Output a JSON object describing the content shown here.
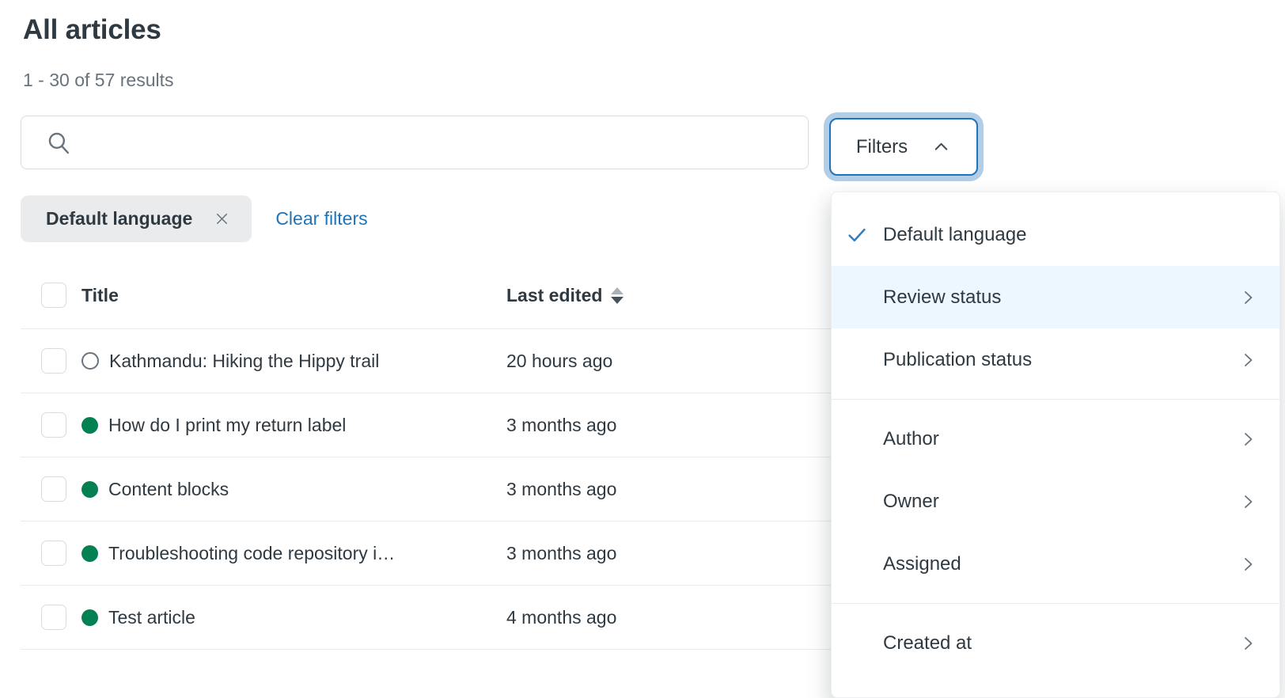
{
  "page": {
    "title": "All articles",
    "results_summary": "1 - 30 of 57 results"
  },
  "search": {
    "value": "",
    "placeholder": ""
  },
  "filters_button": {
    "label": "Filters",
    "state": "open"
  },
  "active_filters": {
    "chips": [
      {
        "label": "Default language"
      }
    ],
    "clear_label": "Clear filters"
  },
  "table": {
    "columns": {
      "title": "Title",
      "last_edited": "Last edited"
    },
    "sort": {
      "column": "last_edited",
      "direction": "descending"
    },
    "rows": [
      {
        "status": "draft",
        "title": "Kathmandu: Hiking the Hippy trail",
        "last_edited": "20 hours ago"
      },
      {
        "status": "published",
        "title": "How do I print my return label",
        "last_edited": "3 months ago"
      },
      {
        "status": "published",
        "title": "Content blocks",
        "last_edited": "3 months ago"
      },
      {
        "status": "published",
        "title": "Troubleshooting code repository i…",
        "last_edited": "3 months ago"
      },
      {
        "status": "published",
        "title": "Test article",
        "last_edited": "4 months ago"
      }
    ]
  },
  "filters_menu": {
    "items": [
      {
        "label": "Default language",
        "selected": true,
        "submenu": false,
        "highlighted": false
      },
      {
        "label": "Review status",
        "selected": false,
        "submenu": true,
        "highlighted": true
      },
      {
        "label": "Publication status",
        "selected": false,
        "submenu": true,
        "highlighted": false
      },
      {
        "divider": true
      },
      {
        "label": "Author",
        "selected": false,
        "submenu": true,
        "highlighted": false
      },
      {
        "label": "Owner",
        "selected": false,
        "submenu": true,
        "highlighted": false
      },
      {
        "label": "Assigned",
        "selected": false,
        "submenu": true,
        "highlighted": false
      },
      {
        "divider": true
      },
      {
        "label": "Created at",
        "selected": false,
        "submenu": true,
        "highlighted": false
      }
    ]
  },
  "icons": {
    "search": "magnifying-glass",
    "filters_chevron": "chevron-up",
    "chip_remove": "x-mark",
    "sort": "up-down-carets",
    "menu_selected": "check-mark",
    "menu_submenu": "chevron-right"
  },
  "colors": {
    "accent_blue": "#1f73b7",
    "link_blue": "#1f73b7",
    "text_primary": "#2f3941",
    "text_secondary": "#68737d",
    "published_green": "#038153",
    "menu_highlight": "#edf7ff",
    "chip_bg": "#e9ebed",
    "border": "#d8dcde",
    "divider": "#e9ebed"
  }
}
